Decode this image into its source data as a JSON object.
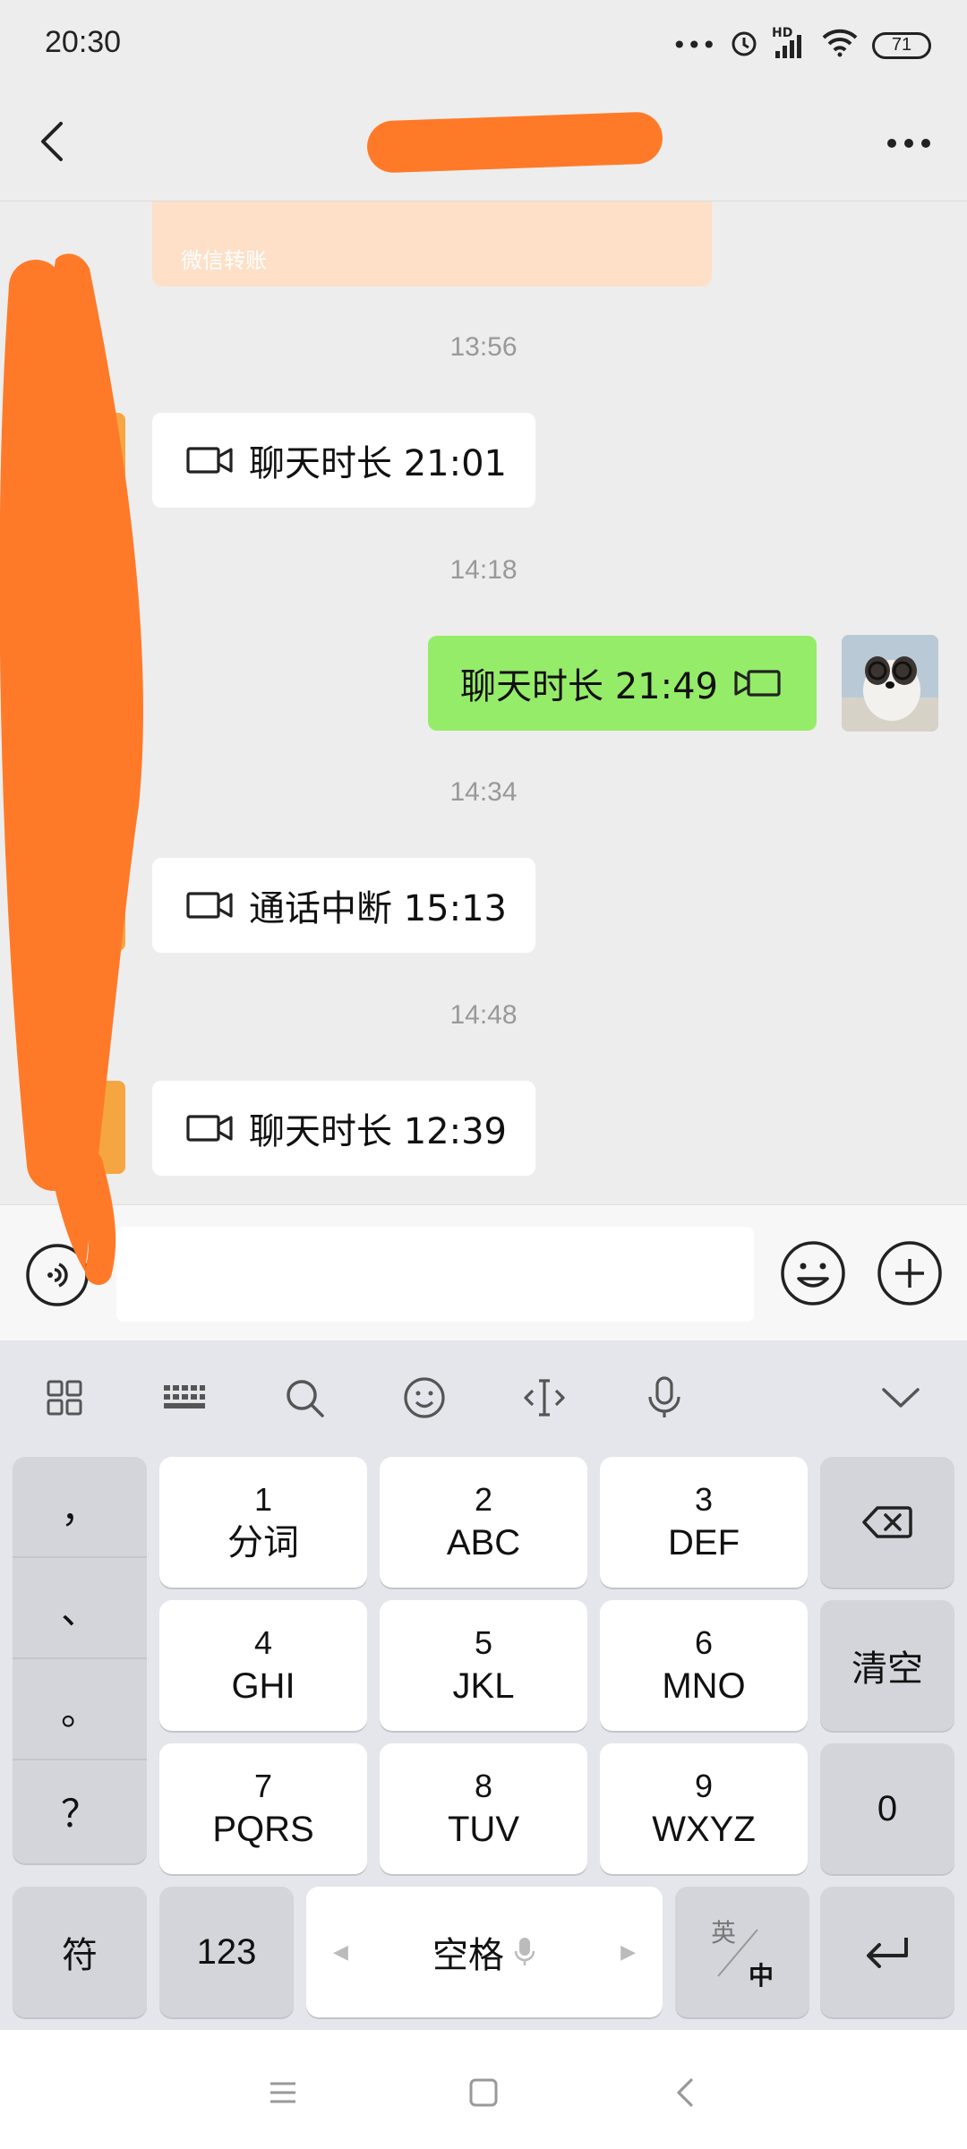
{
  "status_bar": {
    "time": "20:30",
    "network": "HD",
    "battery": "71"
  },
  "chat": {
    "transfer": {
      "label": "微信转账"
    },
    "messages": [
      {
        "time": "13:56",
        "side": "left",
        "text": "聊天时长 21:01",
        "icon": "video-call-icon"
      },
      {
        "time": "14:18",
        "side": "right",
        "text": "聊天时长 21:49",
        "icon": "video-call-icon"
      },
      {
        "time": "14:34",
        "side": "left",
        "text": "通话中断 15:13",
        "icon": "video-call-icon"
      },
      {
        "time": "14:48",
        "side": "left",
        "text": "聊天时长 12:39",
        "icon": "video-call-icon"
      }
    ]
  },
  "input": {
    "value": "",
    "placeholder": ""
  },
  "keyboard": {
    "toolbar": [
      "grid-icon",
      "keyboard-icon",
      "search-icon",
      "emoji-icon",
      "cursor-icon",
      "mic-icon",
      "collapse-icon"
    ],
    "punctuation": [
      "，",
      "、",
      "。",
      "？"
    ],
    "keys": [
      {
        "num": "1",
        "letters": "分词"
      },
      {
        "num": "2",
        "letters": "ABC"
      },
      {
        "num": "3",
        "letters": "DEF"
      },
      {
        "num": "4",
        "letters": "GHI"
      },
      {
        "num": "5",
        "letters": "JKL"
      },
      {
        "num": "6",
        "letters": "MNO"
      },
      {
        "num": "7",
        "letters": "PQRS"
      },
      {
        "num": "8",
        "letters": "TUV"
      },
      {
        "num": "9",
        "letters": "WXYZ"
      }
    ],
    "clear": "清空",
    "zero": "0",
    "symbols": "符",
    "numbers": "123",
    "space": "空格",
    "lang_top": "英",
    "lang_bottom": "中"
  },
  "colors": {
    "accent_green": "#95ec69",
    "redaction": "#ff7a28",
    "background": "#ededed"
  }
}
